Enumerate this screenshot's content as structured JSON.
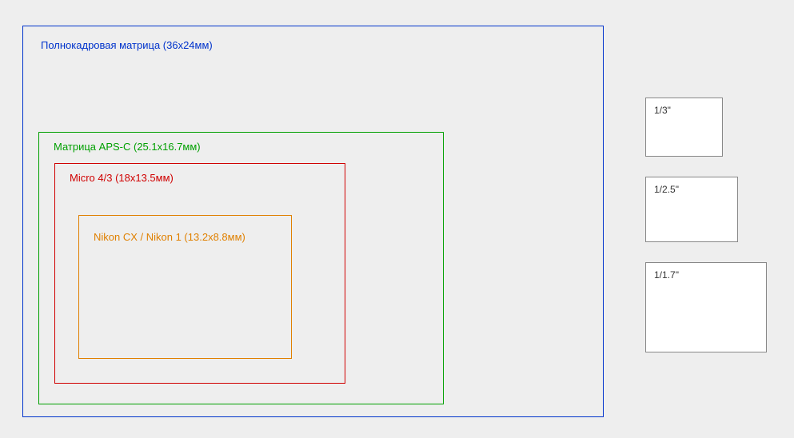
{
  "sensors": {
    "full_frame": {
      "label": "Полнокадровая матрица (36х24мм)",
      "color": "#0033cc",
      "width_mm": 36,
      "height_mm": 24
    },
    "aps_c": {
      "label": "Матрица APS-C (25.1х16.7мм)",
      "color": "#00a000",
      "width_mm": 25.1,
      "height_mm": 16.7
    },
    "micro43": {
      "label": "Micro 4/3 (18х13.5мм)",
      "color": "#d00000",
      "width_mm": 18,
      "height_mm": 13.5
    },
    "nikon_cx": {
      "label": "Nikon CX / Nikon 1 (13.2x8.8мм)",
      "color": "#e08000",
      "width_mm": 13.2,
      "height_mm": 8.8
    }
  },
  "small_sensors": {
    "one_third": {
      "label": "1/3\""
    },
    "one_two_five": {
      "label": "1/2.5\""
    },
    "one_one_seven": {
      "label": "1/1.7\""
    }
  }
}
